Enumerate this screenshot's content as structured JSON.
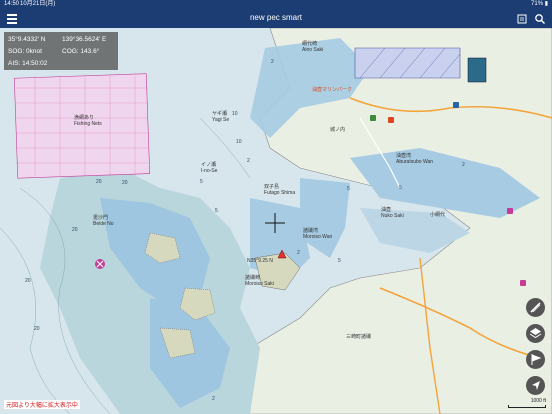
{
  "status": {
    "time": "14:50",
    "date": "10月21日(月)",
    "right": "71% ▮"
  },
  "header": {
    "title": "new pec smart",
    "menu_icon": "hamburger-icon",
    "right_icons": [
      "book-icon",
      "search-icon"
    ]
  },
  "info": {
    "lat": "35°9.4332' N",
    "lon": "139°36.5624' E",
    "sog": "SOG: 0knot",
    "cog": "COG: 143.6°",
    "ais": "AIS: 14:50:02"
  },
  "labels": {
    "fishing_nets": "漁網あり\nFishing Nets",
    "yagi_se": "ヤギ瀬\nYagi Se",
    "i_no_se": "イノ瀬\nI-no-Se",
    "aino_saki": "網代崎\nAino Saki",
    "futago": "双子島\nFutago Shima",
    "aburatsubo": "油壺湾\nAburatsubo Wan",
    "moroiso": "諸磯湾\nMoroiso Wan",
    "moroiso_saki": "諸磯崎\nMoroiso Saki",
    "nuko": "油壺\nNuko Saki",
    "bishamon": "毘沙門\nBeide No",
    "jonai": "城ノ内",
    "koajiro": "小網代",
    "misaki": "三崎町諸磯",
    "marina": "油壺マリンパーク",
    "position": "N35°9.25 N"
  },
  "depths": [
    "2",
    "10",
    "5",
    "20",
    "20",
    "2",
    "5",
    "5",
    "2",
    "20",
    "20",
    "20",
    "2",
    "5",
    "10",
    "5",
    "2"
  ],
  "controls": [
    "ruler-icon",
    "layers-icon",
    "route-flag-icon",
    "navigate-arrow-icon"
  ],
  "notice": "元図より大幅に拡大表示中",
  "scale": "1000 ft",
  "colors": {
    "nav": "#1b3d73",
    "deep_water": "#d2e3ea",
    "shallow": "#9fc6e0",
    "land": "#e9eee4",
    "danger": "#c43c96"
  }
}
